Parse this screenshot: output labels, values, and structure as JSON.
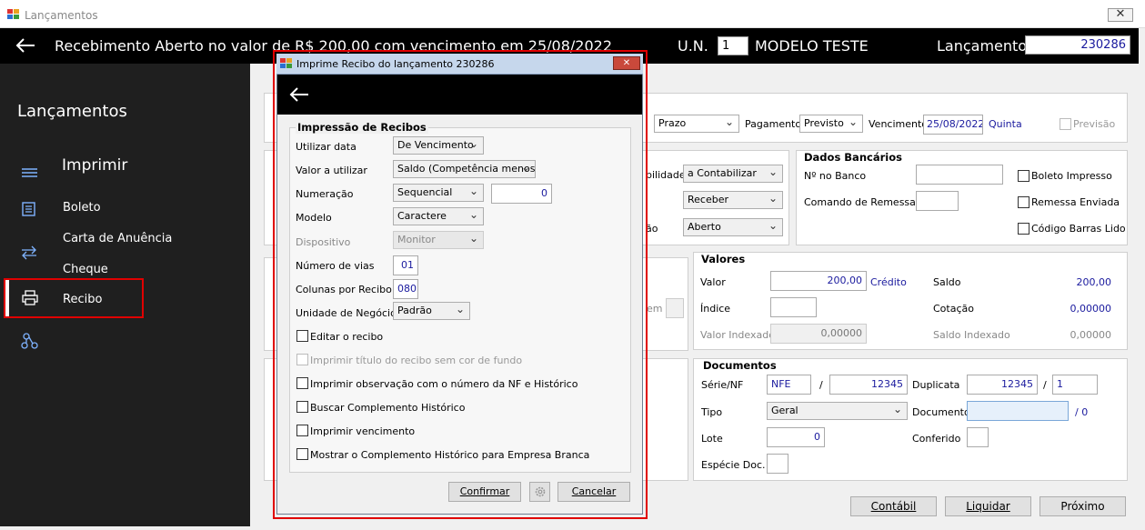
{
  "window": {
    "title": "Lançamentos",
    "close_glyph": "✕"
  },
  "header": {
    "title": "Recebimento Aberto no valor de R$ 200,00 com vencimento em 25/08/2022",
    "un_label": "U.N.",
    "un_value": "1",
    "company": "MODELO TESTE",
    "lancamento_label": "Lançamento",
    "lancamento_value": "230286"
  },
  "sidebar": {
    "title": "Lançamentos",
    "menu_heading": "Imprimir",
    "items": [
      {
        "label": "Boleto",
        "icon": "document-icon"
      },
      {
        "label": "Carta de Anuência",
        "icon": "exchange-icon"
      },
      {
        "label": "Cheque",
        "icon": "exchange-icon"
      },
      {
        "label": "Recibo",
        "icon": "printer-icon"
      },
      {
        "label": "",
        "icon": "workflow-icon"
      }
    ]
  },
  "form": {
    "prazo": "Prazo",
    "pagamento_label": "Pagamento",
    "pagamento_value": "Previsto",
    "vencimento_label": "Vencimento",
    "vencimento_value": "25/08/2022",
    "vencimento_day": "Quinta",
    "previsao_label": "Previsão",
    "frag_bilidade": "bilidade",
    "frag_ao": "ão",
    "frag_em": "em",
    "contabilizar": "a Contabilizar",
    "receber": "Receber",
    "aberto": "Aberto",
    "dados_bancarios": {
      "title": "Dados Bancários",
      "no_banco": "Nº no Banco",
      "comando": "Comando de Remessa",
      "boleto_impresso": "Boleto Impresso",
      "remessa_enviada": "Remessa Enviada",
      "codigo_barras": "Código Barras Lido"
    },
    "valores": {
      "title": "Valores",
      "valor_label": "Valor",
      "valor_value": "200,00",
      "credito": "Crédito",
      "saldo_label": "Saldo",
      "saldo_value": "200,00",
      "indice_label": "Índice",
      "cotacao_label": "Cotação",
      "cotacao_value": "0,00000",
      "valor_indexado_label": "Valor Indexado",
      "valor_indexado_value": "0,00000",
      "saldo_indexado_label": "Saldo Indexado",
      "saldo_indexado_value": "0,00000"
    },
    "documentos": {
      "title": "Documentos",
      "serie_label": "Série/NF",
      "serie_value": "NFE",
      "slash": "/",
      "nf_value": "12345",
      "duplicata_label": "Duplicata",
      "duplicata_value": "12345",
      "duplicata_parcela": "1",
      "tipo_label": "Tipo",
      "tipo_value": "Geral",
      "documento_label": "Documento",
      "documento_suffix": "/  0",
      "lote_label": "Lote",
      "lote_value": "0",
      "conferido_label": "Conferido",
      "especie_label": "Espécie Doc."
    }
  },
  "footer": {
    "contabil": "Contábil",
    "liquidar": "Liquidar",
    "proximo": "Próximo"
  },
  "dialog": {
    "title": "Imprime Recibo do lançamento 230286",
    "close_glyph": "✕",
    "group_title": "Impressão de Recibos",
    "utilizar_data_label": "Utilizar data",
    "utilizar_data_value": "De Vencimento",
    "valor_utilizar_label": "Valor a utilizar",
    "valor_utilizar_value": "Saldo (Competência menos d",
    "numeracao_label": "Numeração",
    "numeracao_value": "Sequencial",
    "numeracao_num": "0",
    "modelo_label": "Modelo",
    "modelo_value": "Caractere",
    "dispositivo_label": "Dispositivo",
    "dispositivo_value": "Monitor",
    "vias_label": "Número de vias",
    "vias_value": "01",
    "colunas_label": "Colunas por Recibo",
    "colunas_value": "080",
    "unidade_label": "Unidade de Negócio",
    "unidade_value": "Padrão",
    "checks": [
      "Editar o recibo",
      "Imprimir título do recibo sem cor de fundo",
      "Imprimir observação com o número da NF e Histórico",
      "Buscar Complemento Histórico",
      "Imprimir vencimento",
      "Mostrar o Complemento Histórico para Empresa Branca"
    ],
    "confirmar": "Confirmar",
    "cancelar": "Cancelar"
  },
  "colors": {
    "accent": "#7fb3ff",
    "highlight_border": "#e00000",
    "value_text": "#1a1a9e"
  }
}
